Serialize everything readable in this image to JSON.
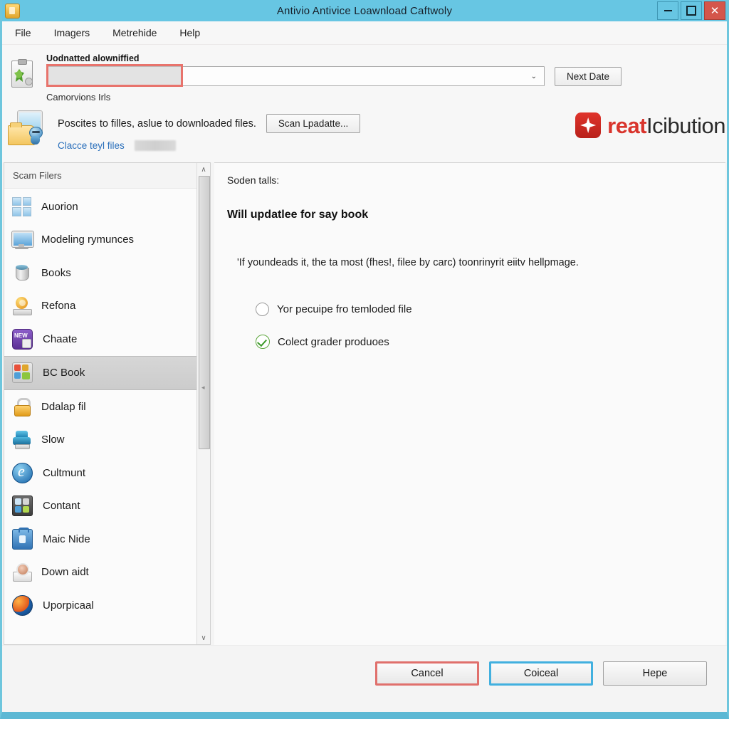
{
  "window": {
    "title": "Antivio Antivice Loawnload Caftwoly",
    "app_icon": "clipboard-app-icon",
    "controls": {
      "minimize": "minimize-icon",
      "maximize": "maximize-icon",
      "close": "✕"
    }
  },
  "menubar": {
    "items": [
      {
        "label": "File"
      },
      {
        "label": "Imagers"
      },
      {
        "label": "Metrehide"
      },
      {
        "label": "Help"
      }
    ]
  },
  "top_form": {
    "field_label": "Uodnatted alowniffied",
    "combo_value": "",
    "combo_chevron": "⌄",
    "next_button": "Next Date",
    "helper_text": "Camorvions Irls"
  },
  "scan_row": {
    "description": "Poscites to filles, aslue to downloaded files.",
    "scan_button": "Scan Lpadatte...",
    "link_text": "Clacce teyl files",
    "redacted_value": ""
  },
  "brand": {
    "mark": "red-star-logo",
    "word_1": "reat",
    "word_2": "Icibution"
  },
  "sidebar": {
    "header": "Scam Filers",
    "scroll": {
      "up_arrow": "∧",
      "down_arrow": "∨",
      "grip": "◂"
    },
    "items": [
      {
        "label": "Auorion",
        "icon": "windows-logo-icon",
        "selected": false
      },
      {
        "label": "Modeling rymunces",
        "icon": "monitor-icon",
        "selected": false
      },
      {
        "label": "Books",
        "icon": "drum-icon",
        "selected": false
      },
      {
        "label": "Refona",
        "icon": "globe-stand-icon",
        "selected": false
      },
      {
        "label": "Chaate",
        "icon": "new-badge-icon",
        "selected": false
      },
      {
        "label": "BC Book",
        "icon": "apps-grid-icon",
        "selected": true
      },
      {
        "label": "Ddalap fil",
        "icon": "lock-icon",
        "selected": false
      },
      {
        "label": "Slow",
        "icon": "printer-icon",
        "selected": false
      },
      {
        "label": "Cultmunt",
        "icon": "internet-explorer-icon",
        "selected": false
      },
      {
        "label": "Contant",
        "icon": "contact-grid-icon",
        "selected": false
      },
      {
        "label": "Maic Nide",
        "icon": "briefcase-icon",
        "selected": false
      },
      {
        "label": "Down aidt",
        "icon": "download-gear-icon",
        "selected": false
      },
      {
        "label": "Uporpicaal",
        "icon": "firefox-globe-icon",
        "selected": false
      }
    ]
  },
  "content": {
    "caption": "Soden talls:",
    "heading": "Will updatlee for say book",
    "paragraph": "'If youndeads it, the ta most (fhes!, filee by carc) toonrinyrit eiitv hellpmage.",
    "options": [
      {
        "label": "Yor pecuipe fro temloded file",
        "control": "radio",
        "checked": false
      },
      {
        "label": "Colect grader produoes",
        "control": "check-circle",
        "checked": true
      }
    ]
  },
  "footer": {
    "buttons": [
      {
        "label": "Cancel",
        "style": "danger"
      },
      {
        "label": "Coiceal",
        "style": "primary"
      },
      {
        "label": "Hepe",
        "style": "normal"
      }
    ]
  },
  "colors": {
    "titlebar": "#67c6e3",
    "close": "#d4564b",
    "accent_red": "#e0706c",
    "accent_blue": "#42b0df",
    "link": "#2a6fbb",
    "brand_red": "#d9342c",
    "check_green": "#3d9a2b"
  }
}
